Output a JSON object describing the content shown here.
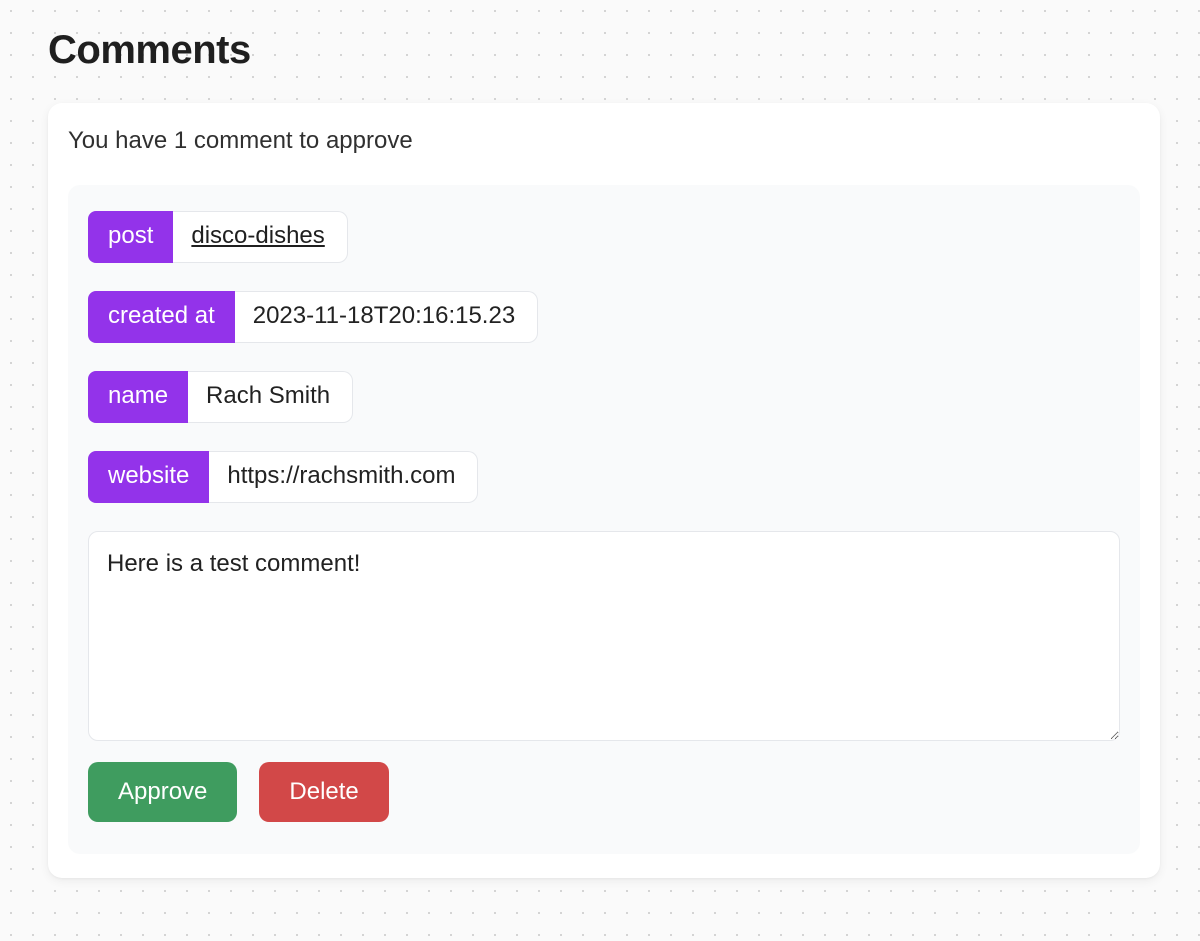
{
  "title": "Comments",
  "subtitle": "You have 1 comment to approve",
  "labels": {
    "post": "post",
    "created_at": "created at",
    "name": "name",
    "website": "website"
  },
  "comment": {
    "post": "disco-dishes",
    "created_at": "2023-11-18T20:16:15.23",
    "name": "Rach Smith",
    "website": "https://rachsmith.com",
    "body": "Here is a test comment!"
  },
  "actions": {
    "approve": "Approve",
    "delete": "Delete"
  },
  "colors": {
    "accent": "#9333ea",
    "approve": "#3f9c5f",
    "delete": "#d24848"
  }
}
